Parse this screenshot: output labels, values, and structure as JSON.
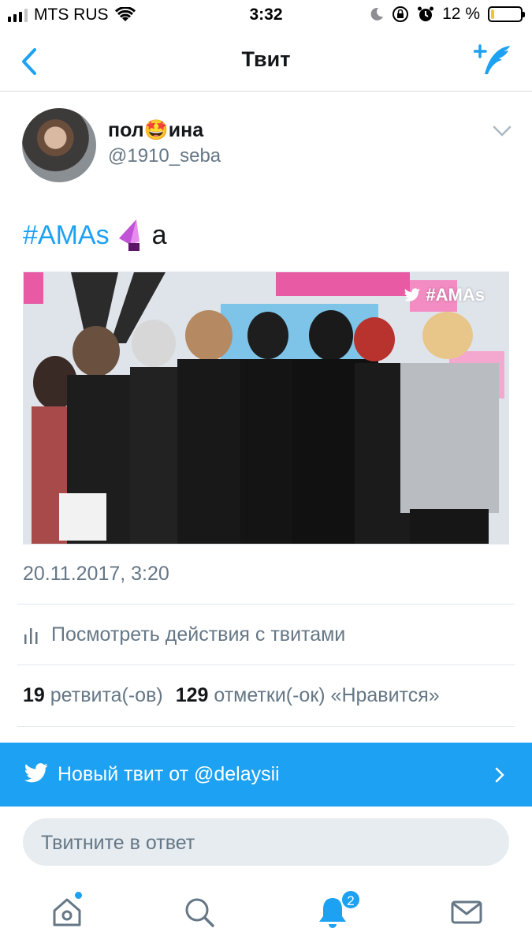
{
  "status_bar": {
    "carrier": "MTS RUS",
    "time": "3:32",
    "battery_percent": "12 %",
    "battery_level": 0.12,
    "icons": [
      "signal-icon",
      "wifi-icon",
      "moon-icon",
      "rotation-lock-icon",
      "alarm-icon",
      "battery-icon"
    ]
  },
  "nav": {
    "title": "Твит",
    "back_icon": "chevron-left-icon",
    "compose_icon": "compose-tweet-icon"
  },
  "tweet": {
    "author_name": "пол🤩ина",
    "author_handle": "@1910_seba",
    "hashtag": "#AMAs",
    "text_suffix": "a",
    "media_watermark": "#AMAs",
    "timestamp": "20.11.2017, 3:20",
    "activity_label": "Посмотреть действия с твитами",
    "retweets_count": "19",
    "retweets_label": "ретвита(-ов)",
    "likes_count": "129",
    "likes_label": "отметки(-ок) «Нравится»"
  },
  "banner": {
    "text": "Новый твит от @delaysii"
  },
  "reply": {
    "placeholder": "Твитните в ответ"
  },
  "tabbar": {
    "notifications_badge": "2",
    "tabs": [
      "home-icon",
      "search-icon",
      "notifications-icon",
      "messages-icon"
    ]
  },
  "colors": {
    "accent": "#1da1f2",
    "secondary_text": "#657786",
    "primary_text": "#14171a"
  }
}
